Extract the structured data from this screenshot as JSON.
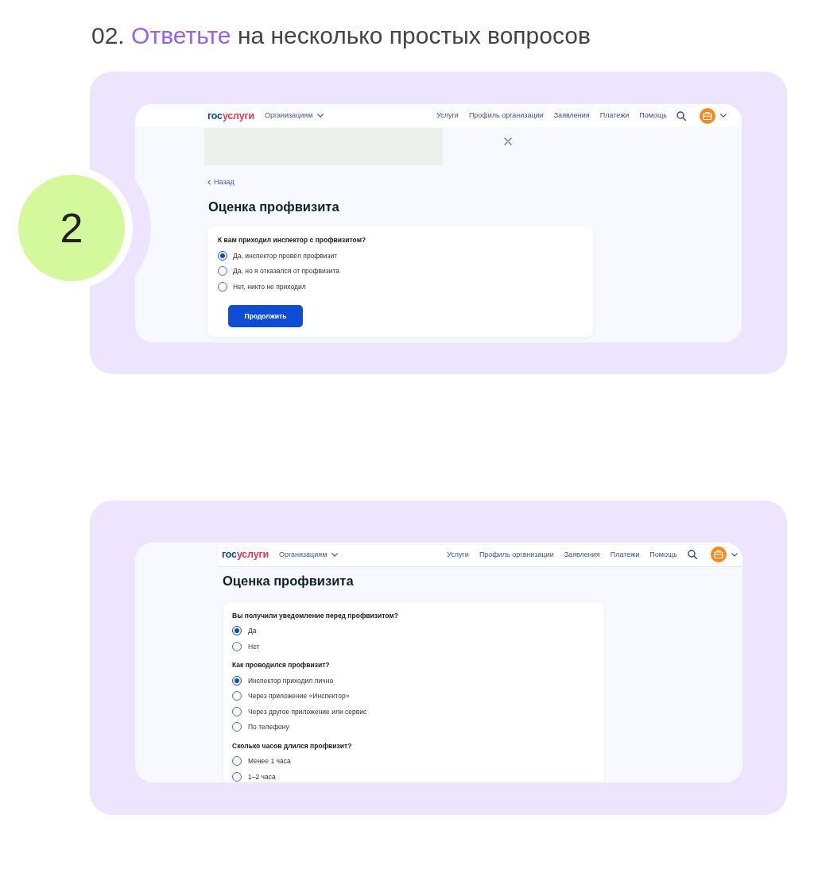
{
  "heading": {
    "parts": [
      {
        "text": "02.",
        "accent": false
      },
      {
        "text": "Ответьте",
        "accent": true
      },
      {
        "text": "на несколько простых вопросов",
        "accent": false
      }
    ]
  },
  "steps": [
    {
      "badge": "2",
      "screen": {
        "header": {
          "logo": {
            "prefix": "гос",
            "suffix": "услуги"
          },
          "menu": "Организациям",
          "links": [
            "Услуги",
            "Профиль организации",
            "Заявления",
            "Платежи",
            "Помощь"
          ]
        },
        "banner": {
          "kind": "image",
          "closable": true
        },
        "back_link": "Назад",
        "title": "Оценка профвизита",
        "card": {
          "questions": [
            {
              "text": "К вам приходил инспектор с профвизитом?",
              "options": [
                {
                  "label": "Да, инспектор провёл профвизит",
                  "selected": true
                },
                {
                  "label": "Да, но я отказался от профвизита",
                  "selected": false
                },
                {
                  "label": "Нет, никто не приходил",
                  "selected": false
                }
              ]
            }
          ],
          "button": "Продолжить"
        }
      }
    },
    {
      "screen": {
        "header": {
          "logo": {
            "prefix": "гос",
            "suffix": "услуги"
          },
          "menu": "Организациям",
          "links": [
            "Услуги",
            "Профиль организации",
            "Заявления",
            "Платежи",
            "Помощь"
          ]
        },
        "title": "Оценка профвизита",
        "card": {
          "questions": [
            {
              "text": "Вы получили уведомление перед профвизитом?",
              "options": [
                {
                  "label": "Да",
                  "selected": true
                },
                {
                  "label": "Нет",
                  "selected": false
                }
              ]
            },
            {
              "text": "Как проводился профвизит?",
              "options": [
                {
                  "label": "Инспектор приходил лично",
                  "selected": true
                },
                {
                  "label": "Через приложение «Инспектор»",
                  "selected": false
                },
                {
                  "label": "Через другое приложение или сервис",
                  "selected": false
                },
                {
                  "label": "По телефону",
                  "selected": false
                }
              ]
            },
            {
              "text": "Сколько часов длился профвизит?",
              "options": [
                {
                  "label": "Менее 1 часа",
                  "selected": false
                },
                {
                  "label": "1–2 часа",
                  "selected": false
                }
              ]
            }
          ]
        }
      }
    }
  ]
}
